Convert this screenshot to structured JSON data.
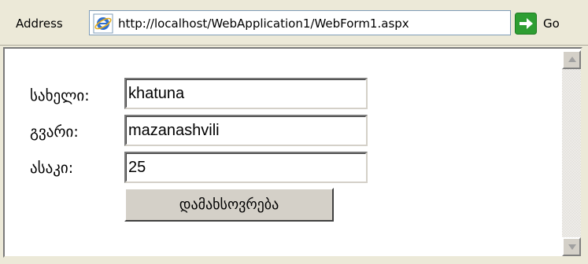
{
  "address_bar": {
    "label": "Address",
    "url": "http://localhost/WebApplication1/WebForm1.aspx",
    "go_label": "Go",
    "page_icon": "ie-page-icon",
    "go_icon": "green-arrow-icon"
  },
  "form": {
    "fields": [
      {
        "label": "სახელი:",
        "value": "khatuna"
      },
      {
        "label": "გვარი:",
        "value": "mazanashvili"
      },
      {
        "label": "ასაკი:",
        "value": "25"
      }
    ],
    "submit_label": "დამახსოვრება"
  },
  "colors": {
    "chrome": "#ece9d8",
    "button_face": "#d4d0c8",
    "go_green": "#2e9e32",
    "ie_blue": "#2f6fd0"
  }
}
